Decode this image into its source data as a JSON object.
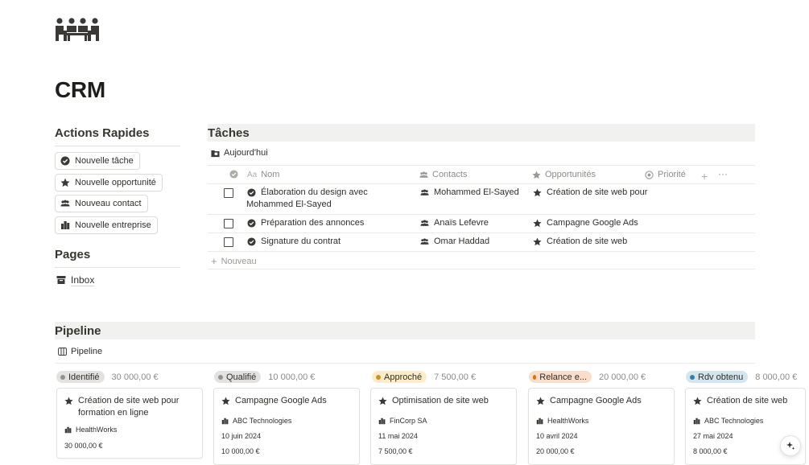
{
  "page": {
    "title": "CRM",
    "icon": "people-meeting-icon"
  },
  "quick_actions": {
    "heading": "Actions Rapides",
    "items": [
      {
        "label": "Nouvelle tâche",
        "icon": "check-circle-icon"
      },
      {
        "label": "Nouvelle opportunité",
        "icon": "star-icon"
      },
      {
        "label": "Nouveau contact",
        "icon": "people-icon"
      },
      {
        "label": "Nouvelle entreprise",
        "icon": "building-icon"
      }
    ]
  },
  "pages": {
    "heading": "Pages",
    "items": [
      {
        "label": "Inbox",
        "icon": "inbox-icon"
      }
    ]
  },
  "tasks": {
    "heading": "Tâches",
    "view_label": "Aujourd'hui",
    "columns": {
      "name": "Nom",
      "name_prefix": "Aa",
      "contacts": "Contacts",
      "opportunities": "Opportunités",
      "priority": "Priorité"
    },
    "rows": [
      {
        "done": false,
        "name": "Élaboration du design avec Mohammed El-Sayed",
        "contact": "Mohammed El-Sayed",
        "opportunity": "Création de site web pour"
      },
      {
        "done": false,
        "name": "Préparation des annonces",
        "contact": "Anaïs Lefevre",
        "opportunity": "Campagne Google Ads"
      },
      {
        "done": false,
        "name": "Signature du contrat",
        "contact": "Omar Haddad",
        "opportunity": "Création de site web"
      }
    ],
    "new_label": "Nouveau"
  },
  "pipeline": {
    "heading": "Pipeline",
    "view_label": "Pipeline",
    "groups": [
      {
        "status": "Identifié",
        "color": "#e3e2e0",
        "dot": "#91918e",
        "total": "30 000,00 €",
        "card": {
          "title": "Création de site web pour formation en ligne",
          "company": "HealthWorks",
          "date": "",
          "amount": "30 000,00 €"
        }
      },
      {
        "status": "Qualifié",
        "color": "#e3e2e0",
        "dot": "#91918e",
        "total": "10 000,00 €",
        "card": {
          "title": "Campagne Google Ads",
          "company": "ABC Technologies",
          "date": "10 juin 2024",
          "amount": "10 000,00 €"
        }
      },
      {
        "status": "Approché",
        "color": "#fdecc8",
        "dot": "#cb912f",
        "total": "7 500,00 €",
        "card": {
          "title": "Optimisation de site web",
          "company": "FinCorp SA",
          "date": "11 mai 2024",
          "amount": "7 500,00 €"
        }
      },
      {
        "status": "Relance e...",
        "color": "#fadec9",
        "dot": "#d9730d",
        "total": "20 000,00 €",
        "card": {
          "title": "Campagne Google Ads",
          "company": "HealthWorks",
          "date": "10 avril 2024",
          "amount": "20 000,00 €"
        }
      },
      {
        "status": "Rdv obtenu",
        "color": "#d3e5ef",
        "dot": "#337ea9",
        "total": "8 000,00 €",
        "card": {
          "title": "Création de site web",
          "company": "ABC Technologies",
          "date": "27 mai 2024",
          "amount": "8 000,00 €"
        }
      }
    ]
  }
}
